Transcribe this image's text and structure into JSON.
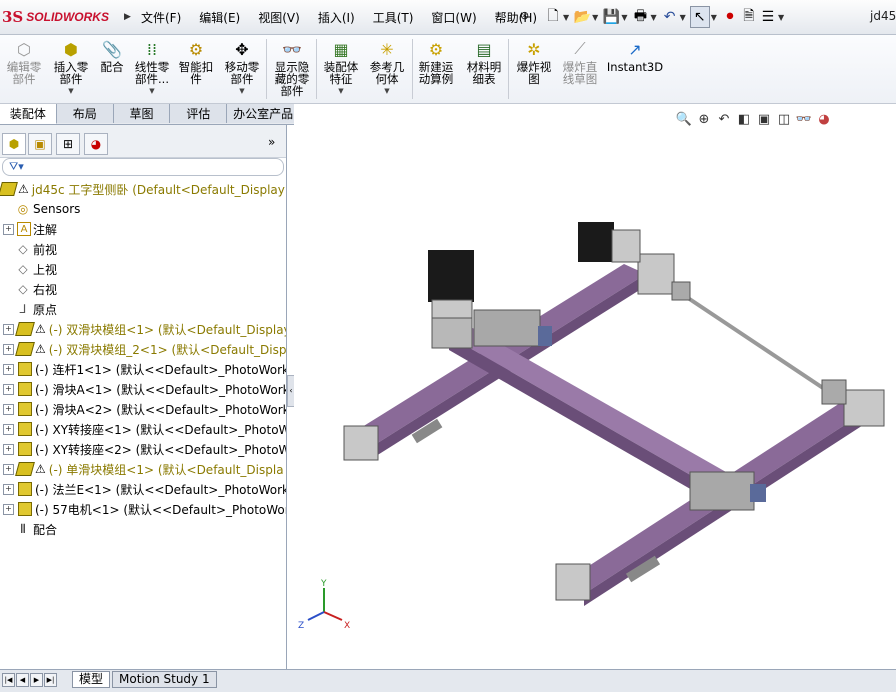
{
  "app": {
    "logo_text": "SOLIDWORKS",
    "window_title": "jd45"
  },
  "menu": [
    "文件(F)",
    "编辑(E)",
    "视图(V)",
    "插入(I)",
    "工具(T)",
    "窗口(W)",
    "帮助(H)"
  ],
  "commands": {
    "edit_component": "编辑零\n部件",
    "insert_component": "插入零\n部件",
    "mate": "配合",
    "linear_pattern": "线性零\n部件...",
    "smart_fasteners": "智能扣\n件",
    "move_component": "移动零\n部件",
    "show_hidden": "显示隐\n藏的零\n部件",
    "assembly_features": "装配体\n特征",
    "reference_geometry": "参考几\n何体",
    "new_motion_study": "新建运\n动算例",
    "bom": "材料明\n细表",
    "exploded_view": "爆炸视\n图",
    "explode_line_sketch": "爆炸直\n线草图",
    "instant3d": "Instant3D"
  },
  "tabs": [
    "装配体",
    "布局",
    "草图",
    "评估",
    "办公室产品"
  ],
  "tree": {
    "root": "jd45c 工字型侧卧  (Default<Default_Display",
    "sensors": "Sensors",
    "annotations": "注解",
    "front_plane": "前视",
    "top_plane": "上视",
    "right_plane": "右视",
    "origin": "原点",
    "items": [
      {
        "label": "(-) 双滑块模组<1> (默认<Default_Display",
        "warning": true,
        "type": "asm"
      },
      {
        "label": "(-) 双滑块模组_2<1> (默认<Default_Disp",
        "warning": true,
        "type": "asm"
      },
      {
        "label": "(-) 连杆1<1> (默认<<Default>_PhotoWork",
        "warning": false,
        "type": "part"
      },
      {
        "label": "(-) 滑块A<1> (默认<<Default>_PhotoWork",
        "warning": false,
        "type": "part"
      },
      {
        "label": "(-) 滑块A<2> (默认<<Default>_PhotoWork",
        "warning": false,
        "type": "part"
      },
      {
        "label": "(-) XY转接座<1> (默认<<Default>_PhotoW",
        "warning": false,
        "type": "part"
      },
      {
        "label": "(-) XY转接座<2> (默认<<Default>_PhotoW",
        "warning": false,
        "type": "part"
      },
      {
        "label": "(-) 单滑块模组<1> (默认<Default_Displa",
        "warning": true,
        "type": "asm"
      },
      {
        "label": "(-) 法兰E<1> (默认<<Default>_PhotoWork",
        "warning": false,
        "type": "part"
      },
      {
        "label": "(-) 57电机<1> (默认<<Default>_PhotoWor",
        "warning": false,
        "type": "part"
      }
    ],
    "mates": "配合"
  },
  "bottom_tabs": [
    "模型",
    "Motion Study 1"
  ],
  "triad": {
    "x": "X",
    "y": "Y",
    "z": "Z"
  },
  "colors": {
    "rail": "#8a6a98",
    "brand": "#c8102e"
  }
}
